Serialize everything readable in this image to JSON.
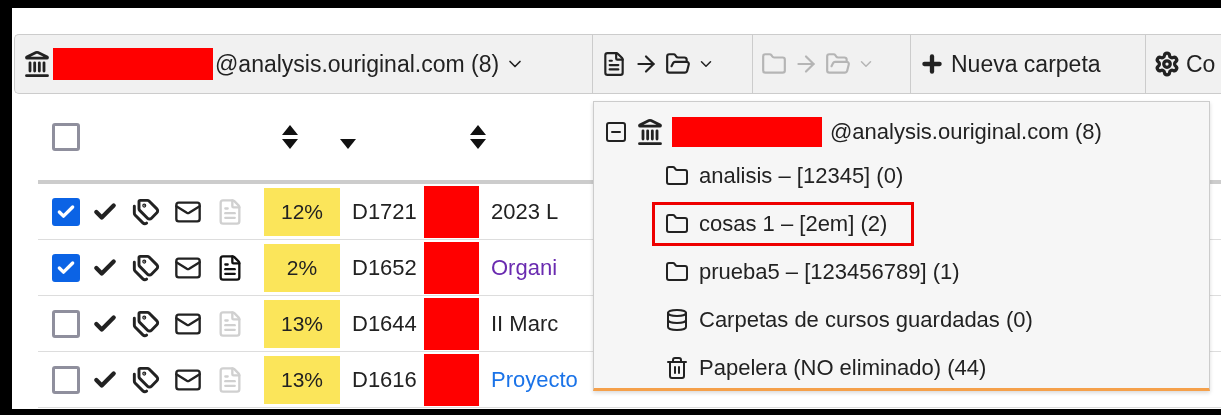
{
  "account_selector": {
    "label": "@analysis.ouriginal.com (8)"
  },
  "toolbar": [
    {
      "kind": "move_document",
      "disabled": false
    },
    {
      "kind": "move_folder",
      "disabled": true
    },
    {
      "kind": "new_folder",
      "label": "Nueva carpeta"
    },
    {
      "kind": "settings",
      "label": "Co"
    }
  ],
  "table": {
    "select_all": {
      "checked": false
    },
    "columns": [
      {
        "sorted": false
      },
      {
        "sorted": true
      },
      {
        "sorted": false
      }
    ],
    "rows": [
      {
        "checked": true,
        "has_document": false,
        "score": "12%",
        "id": "D1721",
        "title": "2023 L",
        "is_link": false
      },
      {
        "checked": true,
        "has_document": true,
        "score": "2%",
        "id": "D1652",
        "title": "Organi",
        "is_link": true,
        "visited": true
      },
      {
        "checked": false,
        "has_document": false,
        "score": "13%",
        "id": "D1644",
        "title": "II Marc",
        "is_link": false
      },
      {
        "checked": false,
        "has_document": false,
        "score": "13%",
        "id": "D1616",
        "title": "Proyecto",
        "is_link": true,
        "visited": false
      }
    ]
  },
  "folder_menu": {
    "root": {
      "label": "@analysis.ouriginal.com (8)",
      "expanded": true,
      "children": [
        {
          "kind": "folder",
          "label": "analisis – [12345] (0)",
          "selected": false
        },
        {
          "kind": "folder",
          "label": "cosas 1 – [2em] (2)",
          "selected": true
        },
        {
          "kind": "folder",
          "label": "prueba5 – [123456789] (1)",
          "selected": false
        },
        {
          "kind": "database",
          "label": "Carpetas de cursos guardadas (0)",
          "selected": false
        },
        {
          "kind": "trash",
          "label": "Papelera (NO eliminado) (44)",
          "selected": false
        }
      ]
    }
  }
}
